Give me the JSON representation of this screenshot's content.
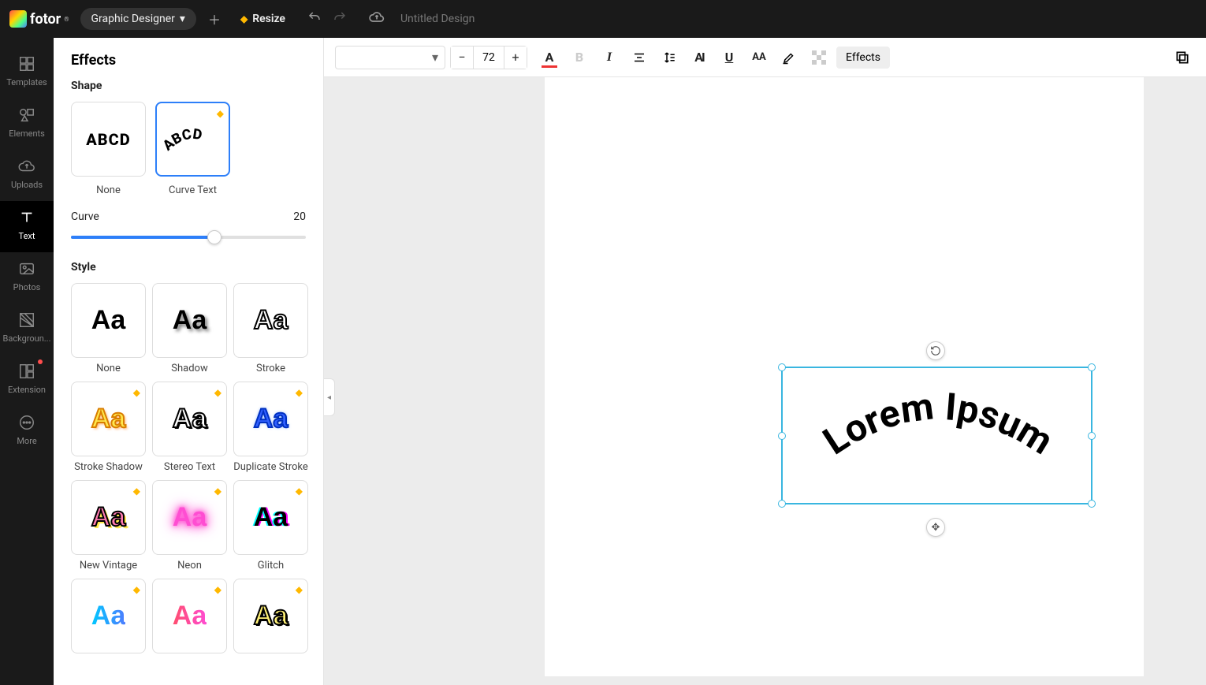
{
  "header": {
    "brand": "fotor",
    "mode": "Graphic Designer",
    "resize": "Resize",
    "doc_title": "Untitled Design"
  },
  "rail": {
    "templates": "Templates",
    "elements": "Elements",
    "uploads": "Uploads",
    "text": "Text",
    "photos": "Photos",
    "background": "Backgroun...",
    "extension": "Extension",
    "more": "More"
  },
  "panel": {
    "title": "Effects",
    "shape_heading": "Shape",
    "shape_none": "None",
    "shape_curve": "Curve Text",
    "shape_sample": "ABCD",
    "curve_label": "Curve",
    "curve_value": "20",
    "style_heading": "Style",
    "styles": {
      "none": "None",
      "shadow": "Shadow",
      "stroke": "Stroke",
      "stroke_shadow": "Stroke Shadow",
      "stereo": "Stereo Text",
      "dup_stroke": "Duplicate Stroke",
      "vintage": "New Vintage",
      "neon": "Neon",
      "glitch": "Glitch"
    }
  },
  "ctx": {
    "font_size": "72",
    "effects": "Effects"
  },
  "canvas": {
    "text": "Lorem Ipsum"
  }
}
